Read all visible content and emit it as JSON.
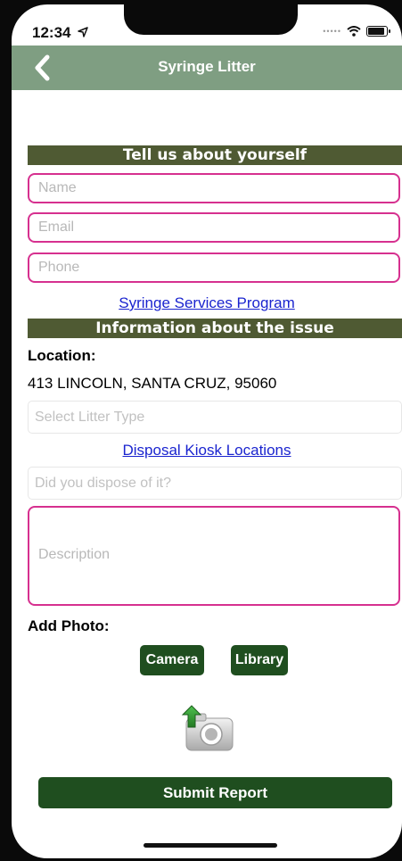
{
  "status_bar": {
    "time": "12:34"
  },
  "nav": {
    "title": "Syringe Litter"
  },
  "about": {
    "header": "Tell us about yourself",
    "name_placeholder": "Name",
    "email_placeholder": "Email",
    "phone_placeholder": "Phone",
    "link": "Syringe Services Program"
  },
  "issue": {
    "header": "Information about the issue",
    "location_label": "Location:",
    "location_value": "413 LINCOLN, SANTA CRUZ, 95060",
    "litter_type_placeholder": "Select Litter Type",
    "kiosk_link": "Disposal Kiosk Locations",
    "dispose_placeholder": "Did you dispose of it?",
    "description_placeholder": "Description"
  },
  "photo": {
    "label": "Add Photo:",
    "camera_button": "Camera",
    "library_button": "Library"
  },
  "submit": {
    "label": "Submit Report"
  },
  "colors": {
    "nav": "#7f9e82",
    "section_header": "#4f5a33",
    "field_border": "#d6308f",
    "button": "#1f4e1f",
    "link": "#1a24cf"
  },
  "icons": [
    "navigation-arrow-icon",
    "wifi-icon",
    "battery-icon",
    "chevron-left-icon",
    "camera-upload-icon"
  ]
}
